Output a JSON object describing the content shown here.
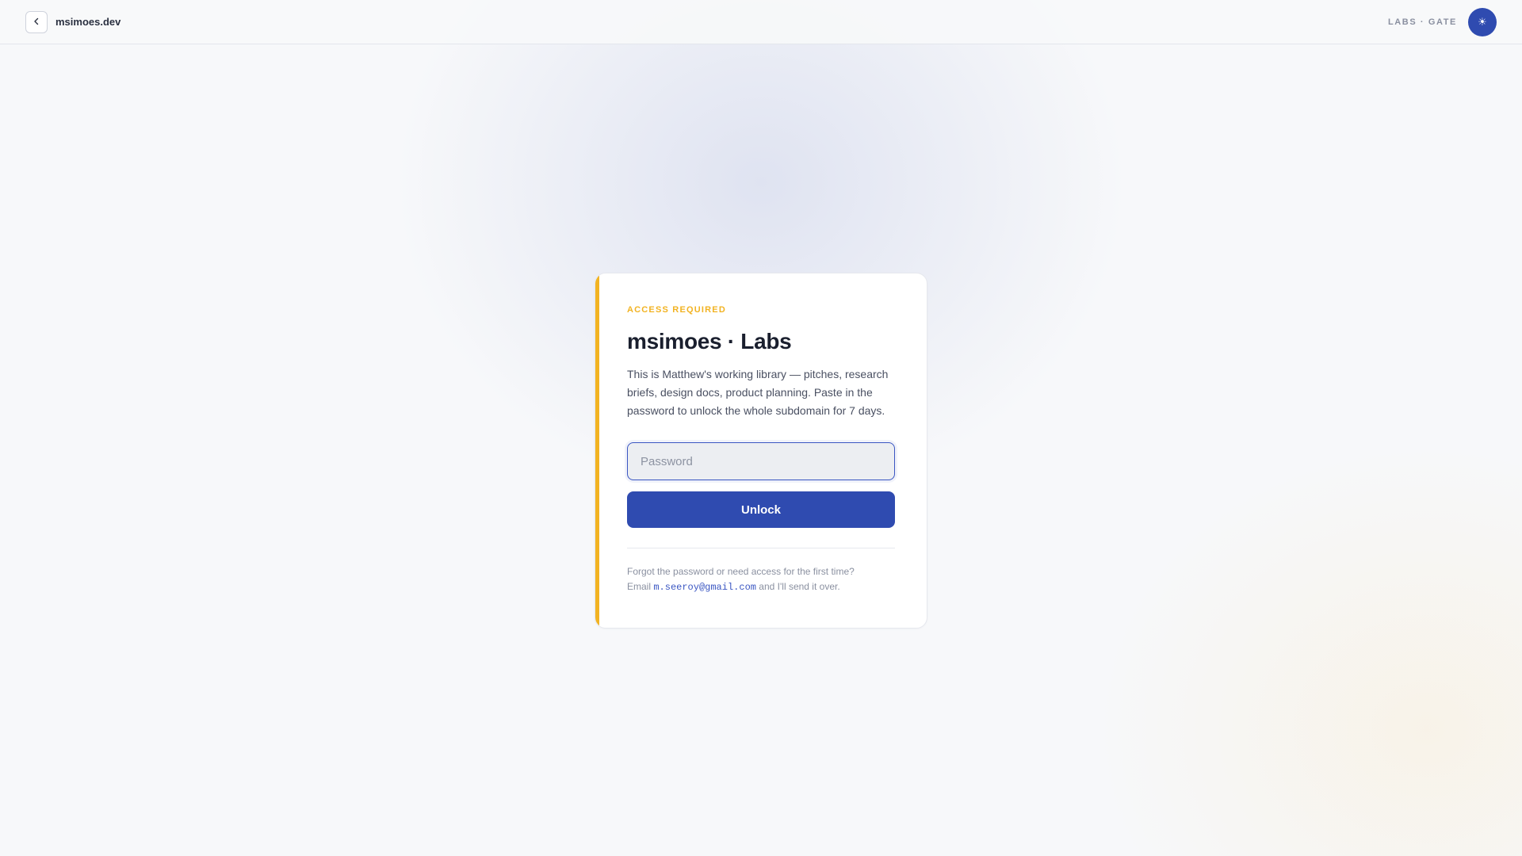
{
  "header": {
    "site_name": "msimoes.dev",
    "section_label": "LABS · GATE",
    "back_icon": "chevron-left-icon",
    "theme_icon": "sun-icon",
    "accent_color": "#2f4bb0"
  },
  "gate": {
    "eyebrow": "ACCESS REQUIRED",
    "title": "msimoes · Labs",
    "description": "This is Matthew's working library — pitches, research briefs, design docs, product planning. Paste in the password to unlock the whole subdomain for 7 days.",
    "password": {
      "placeholder": "Password",
      "value": ""
    },
    "unlock_label": "Unlock",
    "help_line1": "Forgot the password or need access for the first time?",
    "help_prefix": "Email ",
    "help_email": "m.seeroy@gmail.com",
    "help_suffix": " and I'll send it over.",
    "eyebrow_color": "#f2b322",
    "button_color": "#2f4bb0"
  }
}
